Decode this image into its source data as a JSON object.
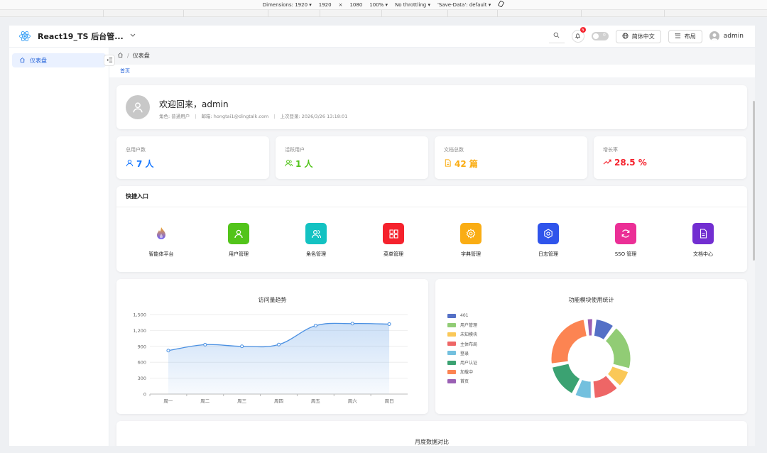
{
  "devtools": {
    "dimensions_label": "Dimensions: 1920 ▾",
    "width": "1920",
    "times": "×",
    "height": "1080",
    "zoom": "100% ▾",
    "throttle": "No throttling ▾",
    "save_data": "'Save-Data': default ▾"
  },
  "header": {
    "title": "React19_TS 后台管...",
    "language_label": "简体中文",
    "layout_label": "布局",
    "user_name": "admin",
    "notification_count": "5",
    "toggle_label": "0"
  },
  "sidebar": {
    "items": [
      {
        "label": "仪表盘"
      }
    ]
  },
  "breadcrumb": {
    "current": "仪表盘",
    "sep": "/"
  },
  "tabs": [
    {
      "label": "首页"
    }
  ],
  "welcome": {
    "title": "欢迎回来，admin",
    "role": "角色: 普通用户",
    "email": "邮箱: hongtai1@dingtalk.com",
    "last_login": "上次登录: 2026/3/26 13:18:01"
  },
  "stats": [
    {
      "label": "总用户数",
      "value": "7 人",
      "color": "#1677ff"
    },
    {
      "label": "活跃用户",
      "value": "1 人",
      "color": "#52c41a"
    },
    {
      "label": "文档总数",
      "value": "42 篇",
      "color": "#faad14"
    },
    {
      "label": "增长率",
      "value": "28.5 %",
      "color": "#f5222d"
    }
  ],
  "quick": {
    "title": "快捷入口",
    "items": [
      {
        "label": "智能体平台",
        "icon": "flame-icon",
        "color": ""
      },
      {
        "label": "用户管理",
        "icon": "user-icon",
        "color": "#52c41a"
      },
      {
        "label": "角色管理",
        "icon": "team-icon",
        "color": "#13c2c2"
      },
      {
        "label": "菜单管理",
        "icon": "grid-icon",
        "color": "#f5222d"
      },
      {
        "label": "字典管理",
        "icon": "gear-icon",
        "color": "#faad14"
      },
      {
        "label": "日志管理",
        "icon": "settings-icon",
        "color": "#2f54eb"
      },
      {
        "label": "SSO 管理",
        "icon": "sync-icon",
        "color": "#eb2f96"
      },
      {
        "label": "文档中心",
        "icon": "file-icon",
        "color": "#722ed1"
      }
    ]
  },
  "chart_data": [
    {
      "type": "area",
      "title": "访问量趋势",
      "categories": [
        "周一",
        "周二",
        "周三",
        "周四",
        "周五",
        "周六",
        "周日"
      ],
      "values": [
        820,
        932,
        901,
        934,
        1290,
        1330,
        1320
      ],
      "ylim": [
        0,
        1500
      ],
      "yticks": [
        "0",
        "300",
        "600",
        "900",
        "1,200",
        "1,500"
      ],
      "grid": true,
      "color": "#4a90e2"
    },
    {
      "type": "pie",
      "title": "功能模块使用统计",
      "legend": "left",
      "labels": [
        "401",
        "用户管理",
        "未知模块",
        "主体布局",
        "登录",
        "用户认证",
        "加载中",
        "首页"
      ],
      "values": [
        10,
        22,
        9,
        13,
        9,
        17,
        29,
        4
      ],
      "colors": [
        "#5470c6",
        "#91cc75",
        "#fac858",
        "#ee6666",
        "#73c0de",
        "#3ba272",
        "#fc8452",
        "#9a60b4"
      ]
    },
    {
      "type": "bar",
      "title": "月度数据对比"
    }
  ]
}
